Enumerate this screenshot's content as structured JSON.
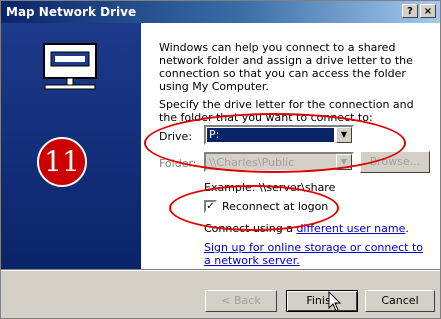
{
  "window": {
    "title": "Map Network Drive",
    "help_label": "?",
    "close_label": "×"
  },
  "annotation": {
    "step_number": "11"
  },
  "intro_text": "Windows can help you connect to a shared network folder and assign a drive letter to the connection so that you can access the folder using My Computer.",
  "specify_text": "Specify the drive letter for the connection and the folder that you want to connect to:",
  "drive": {
    "label": "Drive:",
    "value": "P:"
  },
  "folder": {
    "label": "Folder:",
    "value": "\\\\Charles\\Public",
    "browse_label": "Browse..."
  },
  "example_text": "Example: \\\\server\\share",
  "reconnect": {
    "label": "Reconnect at logon",
    "checked": true
  },
  "connect_using": {
    "prefix": "Connect using a ",
    "link": "different user name",
    "suffix": "."
  },
  "signup_link": "Sign up for online storage or connect to a network server.",
  "buttons": {
    "back": "< Back",
    "finish": "Finish",
    "cancel": "Cancel"
  },
  "colors": {
    "title_start": "#0a246a",
    "title_end": "#a6caf0",
    "selection": "#0a246a",
    "annotation_red": "#e00000",
    "link": "#0000cc"
  }
}
